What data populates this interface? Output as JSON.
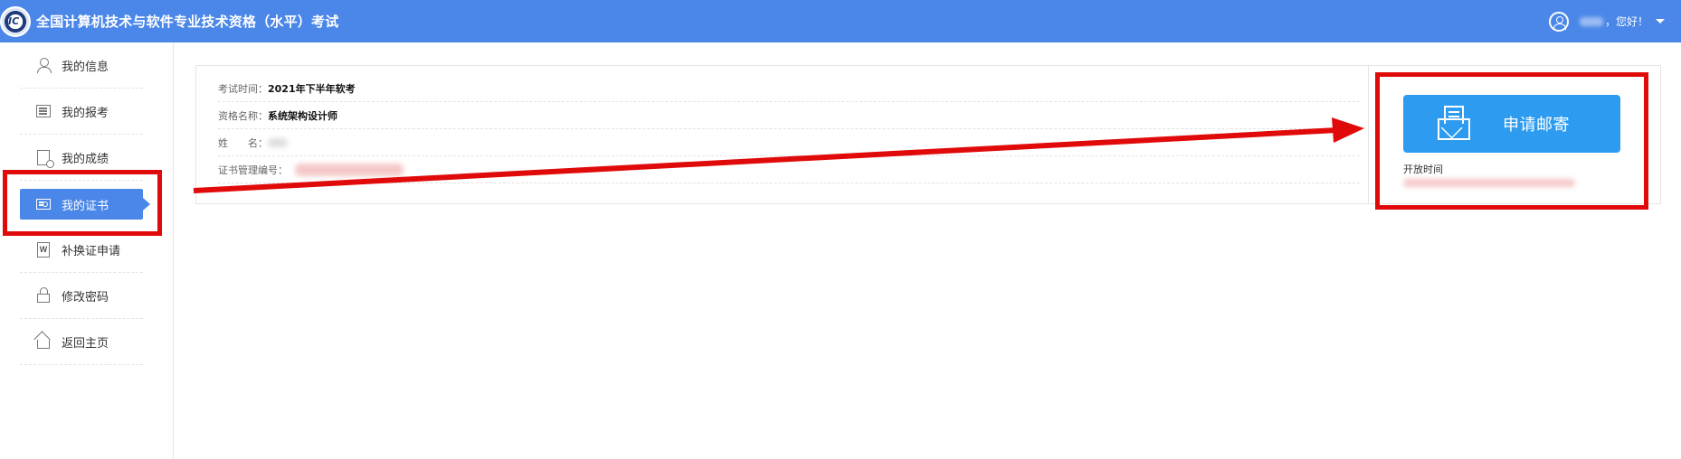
{
  "header": {
    "title": "全国计算机技术与软件专业技术资格（水平）考试",
    "greeting": "，您好！",
    "user_icon": "user-circle-icon",
    "caret_icon": "chevron-down-icon"
  },
  "sidebar": {
    "items": [
      {
        "label": "我的信息",
        "icon": "user-icon"
      },
      {
        "label": "我的报考",
        "icon": "list-icon"
      },
      {
        "label": "我的成绩",
        "icon": "score-search-icon"
      },
      {
        "label": "我的证书",
        "icon": "certificate-icon",
        "active": true
      },
      {
        "label": "补换证申请",
        "icon": "word-document-icon"
      },
      {
        "label": "修改密码",
        "icon": "lock-icon"
      },
      {
        "label": "返回主页",
        "icon": "home-icon"
      }
    ]
  },
  "certificate": {
    "exam_time_label": "考试时间：",
    "exam_time_value": "2021年下半年软考",
    "qualification_label": "资格名称：",
    "qualification_value": "系统架构设计师",
    "name_label": "姓　　名：",
    "cert_number_label": "证书管理编号："
  },
  "mail": {
    "apply_label": "申请邮寄",
    "apply_icon": "mail-envelope-icon",
    "open_time_label": "开放时间"
  },
  "colors": {
    "header_bg": "#4a87e8",
    "active_nav": "#4a87e8",
    "apply_button": "#2d9cf0",
    "annotation_red": "#e00a0a"
  }
}
